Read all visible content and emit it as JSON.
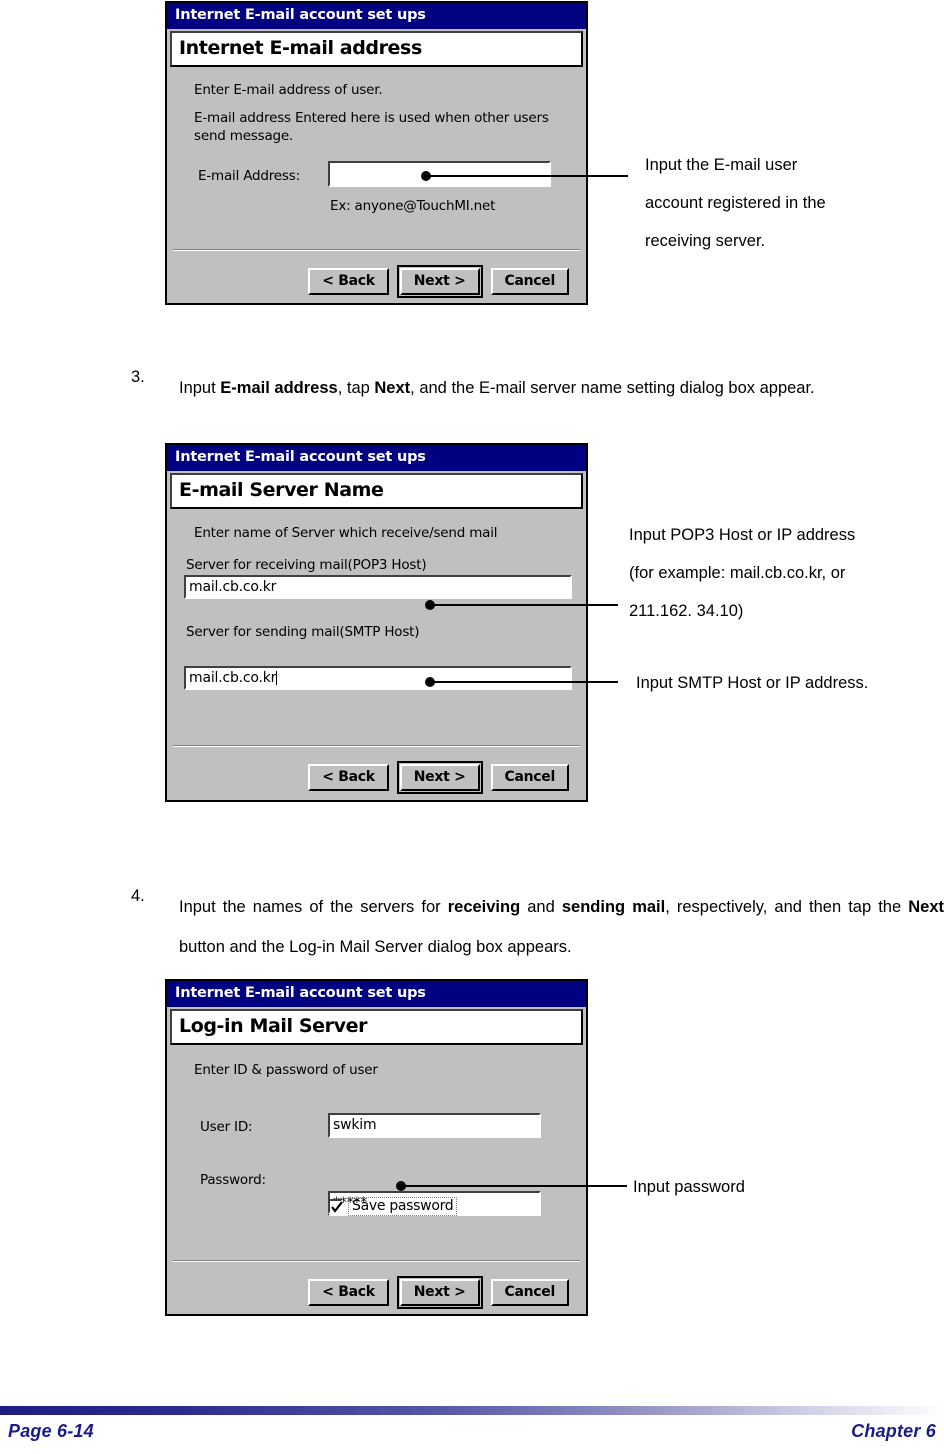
{
  "document": {
    "footer": {
      "page_label": "Page 6-14",
      "chapter_label": "Chapter 6"
    },
    "steps": [
      {
        "number": "3.",
        "segments": [
          {
            "text": "Input ",
            "bold": false
          },
          {
            "text": "E-mail address",
            "bold": true
          },
          {
            "text": ", tap ",
            "bold": false
          },
          {
            "text": "Next",
            "bold": true
          },
          {
            "text": ", and the E-mail server name setting dialog box appear.",
            "bold": false
          }
        ]
      },
      {
        "number": "4.",
        "segments": [
          {
            "text": "Input the names of the servers for ",
            "bold": false
          },
          {
            "text": "receiving",
            "bold": true
          },
          {
            "text": " and ",
            "bold": false
          },
          {
            "text": "sending mail",
            "bold": true
          },
          {
            "text": ", respectively, and then tap the ",
            "bold": false
          },
          {
            "text": "Next",
            "bold": true
          },
          {
            "text": " button and the Log-in Mail Server dialog box appears.",
            "bold": false
          }
        ]
      }
    ]
  },
  "dialog1": {
    "titlebar": "Internet E-mail account set ups",
    "heading": "Internet E-mail address",
    "intro_line1": "Enter E-mail address of user.",
    "intro_line2": "E-mail address Entered here is used when other users",
    "intro_line3": "send message.",
    "field_label": "E-mail Address:",
    "field_value": "",
    "example": "Ex: anyone@TouchMI.net",
    "buttons": {
      "back": "< Back",
      "next": "Next >",
      "cancel": "Cancel"
    }
  },
  "dialog2": {
    "titlebar": "Internet E-mail account set ups",
    "heading": "E-mail Server Name",
    "intro": "Enter name of Server which receive/send mail",
    "pop3_label": "Server for receiving mail(POP3 Host)",
    "pop3_value": "mail.cb.co.kr",
    "smtp_label": "Server for sending mail(SMTP Host)",
    "smtp_value": "mail.cb.co.kr",
    "buttons": {
      "back": "< Back",
      "next": "Next >",
      "cancel": "Cancel"
    }
  },
  "dialog3": {
    "titlebar": "Internet E-mail account set ups",
    "heading": "Log-in Mail Server",
    "intro": "Enter ID & password of user",
    "userid_label": "User ID:",
    "userid_value": "swkim",
    "password_label": "Password:",
    "password_value": "*****",
    "save_password_label": "Save password",
    "save_password_checked": true,
    "buttons": {
      "back": "< Back",
      "next": "Next >",
      "cancel": "Cancel"
    }
  },
  "annotations": {
    "a1": {
      "line1": "Input the E-mail user",
      "line2": "account registered in the",
      "line3": "receiving server."
    },
    "a2": {
      "line1": "Input POP3 Host or IP address",
      "line2": "(for example: mail.cb.co.kr, or",
      "line3": "211.162. 34.10)"
    },
    "a3": {
      "line1": "Input SMTP Host or IP address."
    },
    "a4": {
      "line1": "Input password"
    }
  }
}
